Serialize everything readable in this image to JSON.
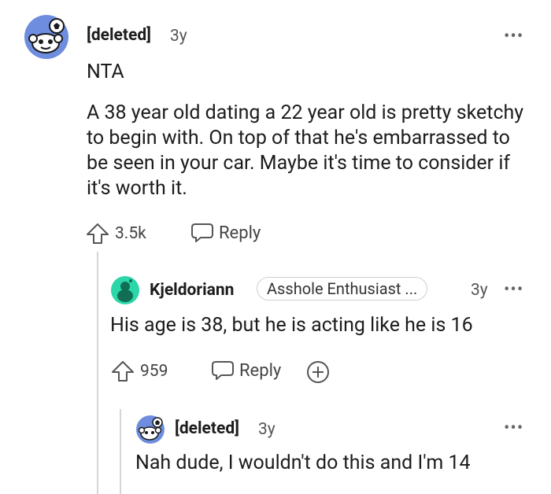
{
  "comments": [
    {
      "username": "[deleted]",
      "age": "3y",
      "paragraphs": [
        "NTA",
        "A 38 year old dating a 22 year old is pretty sketchy to begin with. On top of that he's embarrassed to be seen in your car. Maybe it's time to consider if it's worth it."
      ],
      "upvotes": "3.5k",
      "reply_label": "Reply",
      "avatar_icon": "snoo-soccer-avatar",
      "avatar_color": "#6e8dde"
    },
    {
      "username": "Kjeldoriann",
      "flair": "Asshole Enthusiast ...",
      "age": "3y",
      "paragraphs": [
        "His age is 38, but he is acting like he is 16"
      ],
      "upvotes": "959",
      "reply_label": "Reply",
      "avatar_icon": "snoo-green-avatar",
      "avatar_color": "#2bd6a8"
    },
    {
      "username": "[deleted]",
      "age": "3y",
      "paragraphs": [
        "Nah dude, I wouldn't do this and I'm 14"
      ],
      "avatar_icon": "snoo-soccer-avatar",
      "avatar_color": "#6e8dde"
    }
  ],
  "more_label": "•••",
  "expand_icon": "plus-circle-icon",
  "upvote_icon": "arrow-up-icon",
  "reply_icon": "speech-bubble-icon"
}
